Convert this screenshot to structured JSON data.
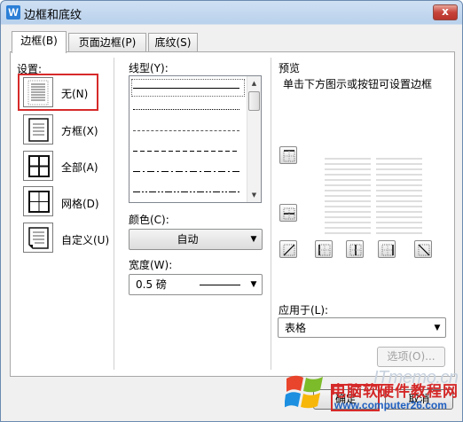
{
  "window": {
    "title": "边框和底纹",
    "app_icon": "W",
    "close_icon": "x"
  },
  "tabs": [
    {
      "label": "边框(B)",
      "active": true
    },
    {
      "label": "页面边框(P)",
      "active": false
    },
    {
      "label": "底纹(S)",
      "active": false
    }
  ],
  "settings": {
    "heading": "设置:",
    "items": [
      {
        "label": "无(N)",
        "icon": "border-none-icon",
        "selected": true
      },
      {
        "label": "方框(X)",
        "icon": "border-box-icon"
      },
      {
        "label": "全部(A)",
        "icon": "border-all-icon"
      },
      {
        "label": "网格(D)",
        "icon": "border-grid-icon"
      },
      {
        "label": "自定义(U)",
        "icon": "border-custom-icon"
      }
    ]
  },
  "style": {
    "heading": "线型(Y):",
    "line_styles": [
      "solid",
      "dotted",
      "dashed-small",
      "dashed",
      "dash-dot",
      "dash-dot-dot"
    ],
    "color_label": "颜色(C):",
    "color_value": "自动",
    "width_label": "宽度(W):",
    "width_value": "0.5  磅"
  },
  "preview": {
    "heading": "预览",
    "hint": "单击下方图示或按钮可设置边框",
    "apply_label": "应用于(L):",
    "apply_value": "表格",
    "options_button": "选项(O)..."
  },
  "footer": {
    "ok": "确定",
    "cancel": "取消"
  },
  "watermark": {
    "url": "ITmemo.cn",
    "brand": "电脑软硬件教程网",
    "site": "www.computer26.com"
  },
  "colors": {
    "highlight": "#d72a2a",
    "titlebar": "#b9d1ec",
    "accent": "#2b7fd6"
  }
}
